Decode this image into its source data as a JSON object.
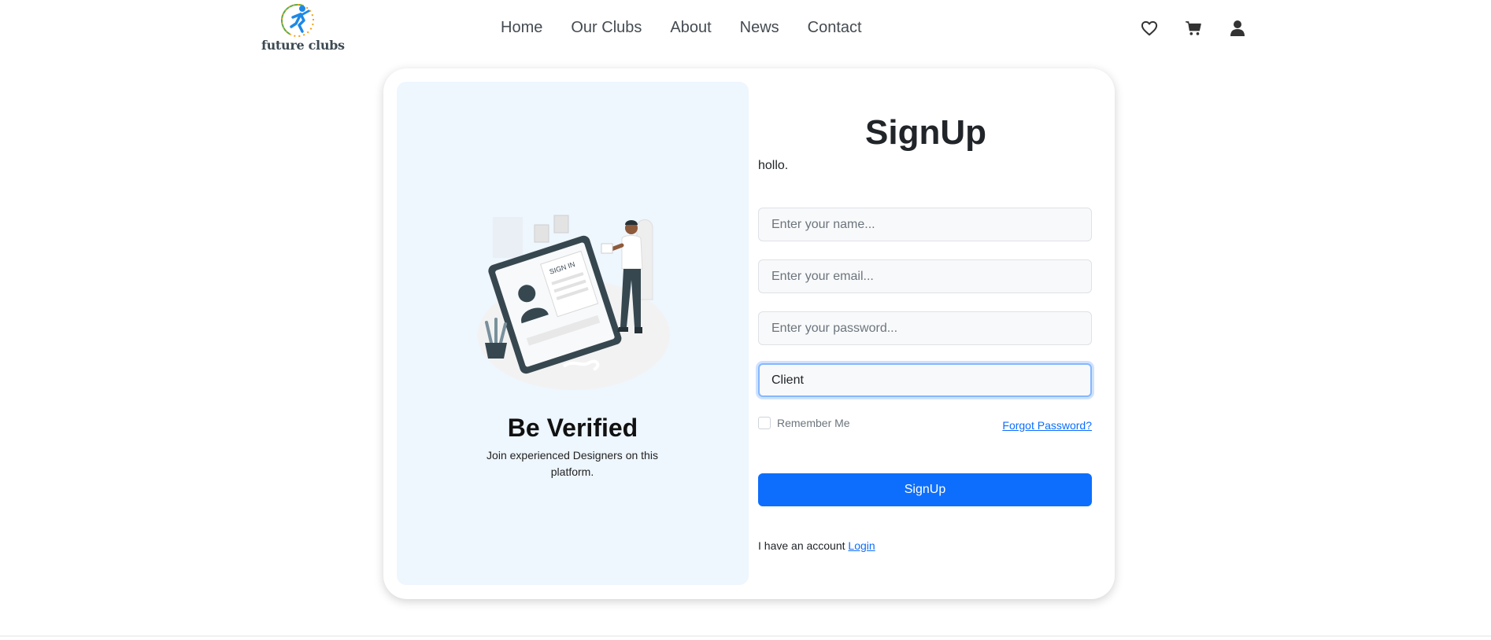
{
  "brand": {
    "name": "future clubs"
  },
  "nav": {
    "items": [
      {
        "label": "Home"
      },
      {
        "label": "Our Clubs"
      },
      {
        "label": "About"
      },
      {
        "label": "News"
      },
      {
        "label": "Contact"
      }
    ]
  },
  "header_icons": [
    "heart-icon",
    "cart-icon",
    "user-icon"
  ],
  "left_panel": {
    "illustration_text": "SIGN IN",
    "title": "Be Verified",
    "subtitle": "Join experienced Designers on this platform."
  },
  "form": {
    "title": "SignUp",
    "subtitle": "hollo.",
    "name_placeholder": "Enter your name...",
    "email_placeholder": "Enter your email...",
    "password_placeholder": "Enter your password...",
    "role_value": "Client",
    "remember_label": "Remember Me",
    "forgot_label": "Forgot Password?",
    "submit_label": "SignUp",
    "account_text": "I have an account",
    "login_label": "Login"
  },
  "colors": {
    "primary": "#0d6efd",
    "panel_bg": "#eef6fe",
    "focus_border": "#86b7fe"
  }
}
